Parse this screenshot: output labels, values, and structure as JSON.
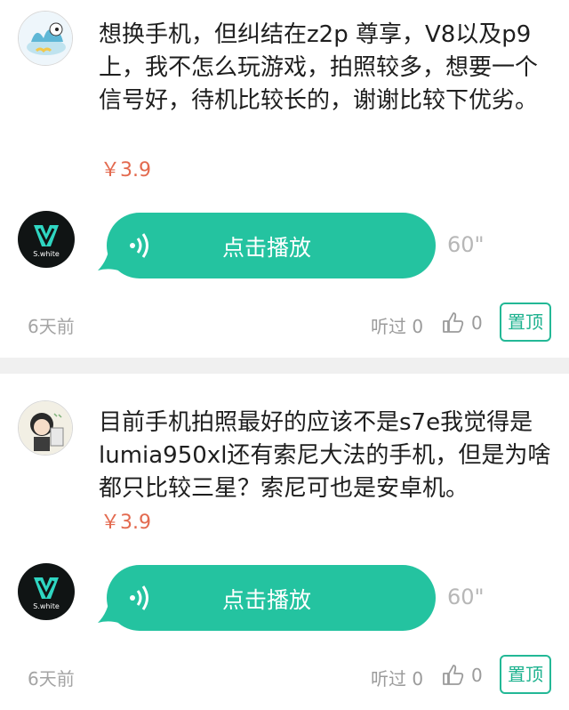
{
  "items": [
    {
      "question": "想换手机，但纠结在z2p 尊享，V8以及p9上，我不怎么玩游戏，拍照较多，想要一个信号好，待机比较长的，谢谢比较下优劣。",
      "price": "￥3.9",
      "answer": {
        "play_label": "点击播放",
        "duration": "60\"",
        "avatar_text": "S.white"
      },
      "time": "6天前",
      "listened": "听过 0",
      "likes": "0",
      "pin_label": "置顶"
    },
    {
      "question": "目前手机拍照最好的应该不是s7e我觉得是lumia950xl还有索尼大法的手机，但是为啥都只比较三星？索尼可也是安卓机。",
      "price": "￥3.9",
      "answer": {
        "play_label": "点击播放",
        "duration": "60\"",
        "avatar_text": "S.white"
      },
      "time": "6天前",
      "listened": "听过 0",
      "likes": "0",
      "pin_label": "置顶"
    }
  ],
  "colors": {
    "accent": "#24c3a0",
    "price": "#e36a4f",
    "muted": "#a4a4a4"
  }
}
